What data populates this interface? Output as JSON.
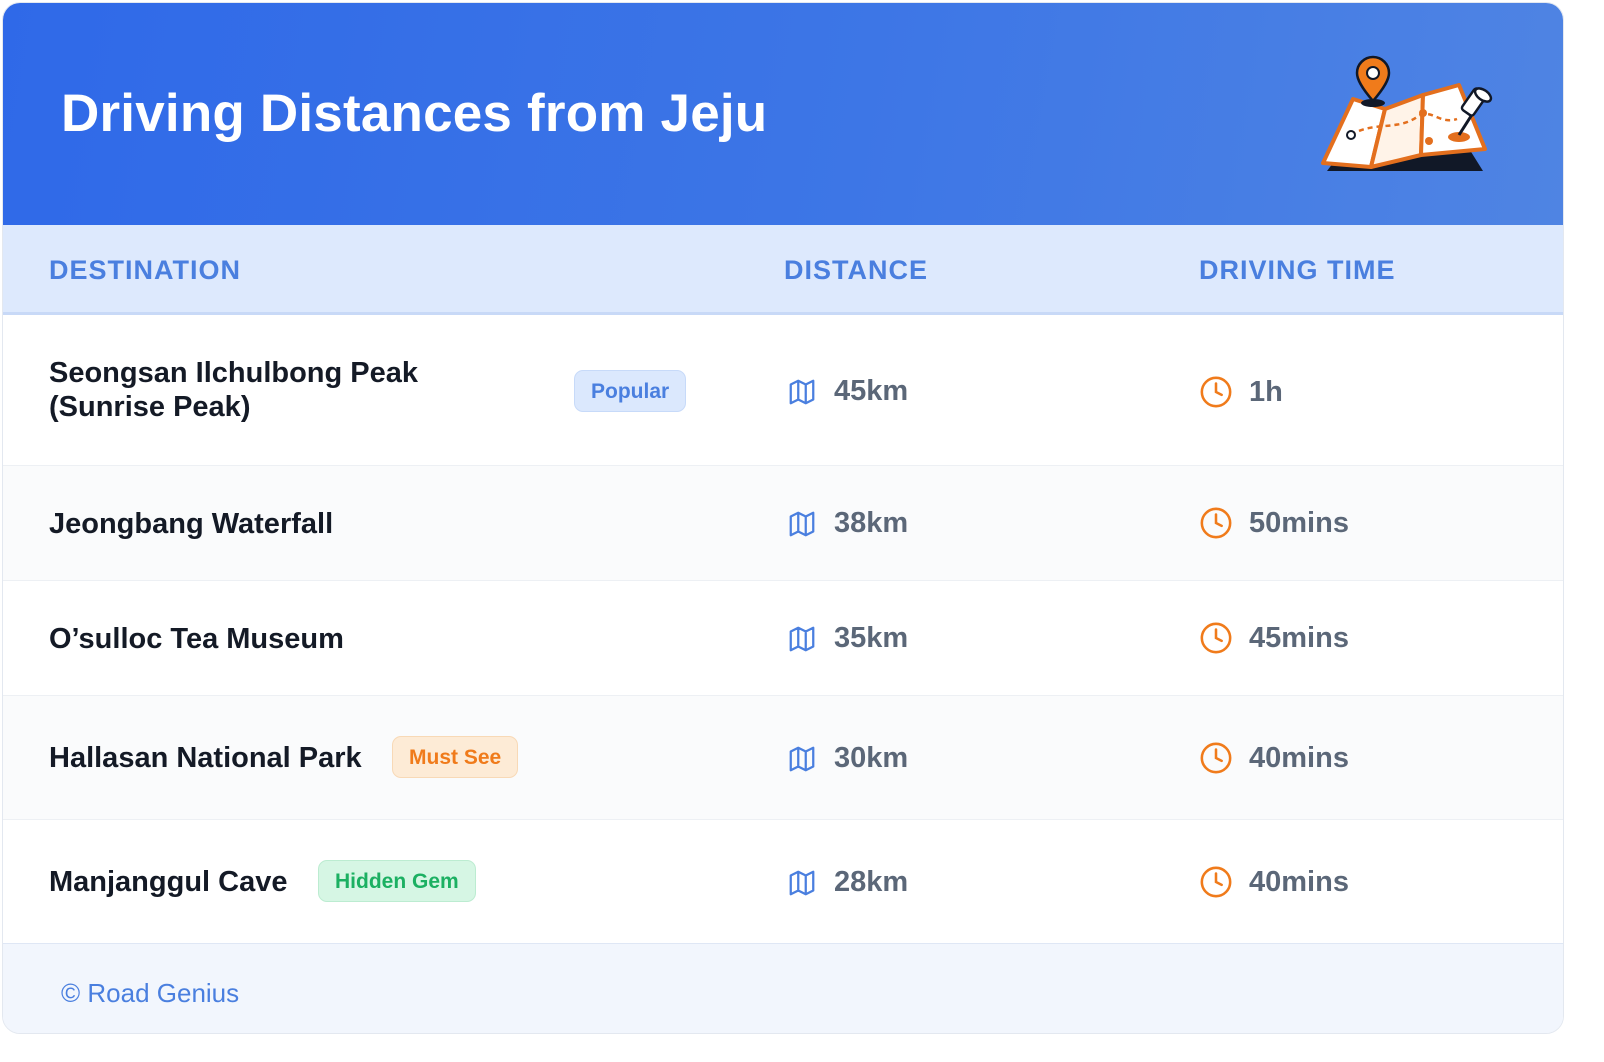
{
  "header": {
    "title": "Driving Distances from Jeju",
    "illustration_icon": "map-with-pins-icon"
  },
  "columns": {
    "destination": "DESTINATION",
    "distance": "DISTANCE",
    "driving_time": "DRIVING TIME"
  },
  "rows": [
    {
      "destination_line1": "Seongsan Ilchulbong Peak",
      "destination_line2": "(Sunrise Peak)",
      "badge": "Popular",
      "distance": "45km",
      "time": "1h"
    },
    {
      "destination": "Jeongbang Waterfall",
      "distance": "38km",
      "time": "50mins"
    },
    {
      "destination": "O’sulloc Tea Museum",
      "distance": "35km",
      "time": "45mins"
    },
    {
      "destination": "Hallasan National Park",
      "badge": "Must See",
      "distance": "30km",
      "time": "40mins"
    },
    {
      "destination": "Manjanggul Cave",
      "badge": "Hidden Gem",
      "distance": "28km",
      "time": "40mins"
    }
  ],
  "icons": {
    "distance": "map-icon",
    "time": "clock-icon"
  },
  "footer": {
    "text": "© Road Genius"
  },
  "colors": {
    "header_start": "#2f69e8",
    "header_end": "#4f84e3",
    "accent_blue": "#4a7fdf",
    "accent_orange": "#f07b1b",
    "accent_green": "#1cb062"
  }
}
